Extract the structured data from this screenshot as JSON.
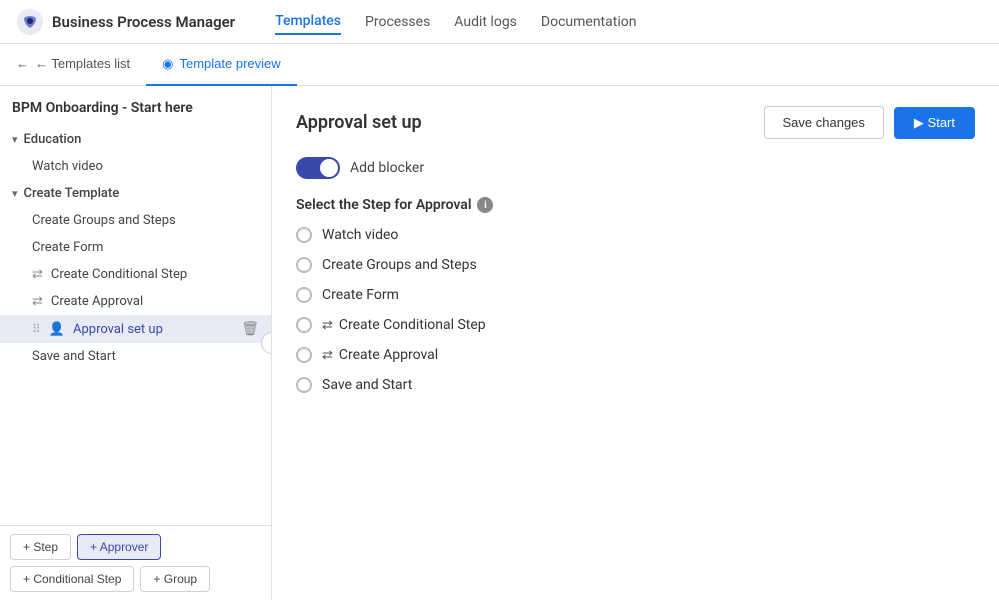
{
  "brand": {
    "name": "Business Process Manager"
  },
  "nav": {
    "items": [
      {
        "id": "templates",
        "label": "Templates",
        "active": true
      },
      {
        "id": "processes",
        "label": "Processes",
        "active": false
      },
      {
        "id": "audit-logs",
        "label": "Audit logs",
        "active": false
      },
      {
        "id": "documentation",
        "label": "Documentation",
        "active": false
      }
    ]
  },
  "tabs": [
    {
      "id": "templates-list",
      "label": "← Templates list",
      "active": false
    },
    {
      "id": "template-preview",
      "label": "Template preview",
      "active": true
    }
  ],
  "sidebar": {
    "title": "BPM Onboarding - Start here",
    "groups": [
      {
        "id": "education",
        "label": "Education",
        "expanded": true,
        "items": [
          {
            "id": "watch-video",
            "label": "Watch video",
            "icon": "",
            "active": false
          }
        ]
      },
      {
        "id": "create-template",
        "label": "Create Template",
        "expanded": true,
        "items": [
          {
            "id": "create-groups-steps",
            "label": "Create Groups and Steps",
            "icon": "",
            "active": false
          },
          {
            "id": "create-form",
            "label": "Create Form",
            "icon": "",
            "active": false
          },
          {
            "id": "create-conditional-step",
            "label": "Create Conditional Step",
            "icon": "⇄",
            "active": false
          },
          {
            "id": "create-approval",
            "label": "Create Approval",
            "icon": "⇄",
            "active": false
          },
          {
            "id": "approval-set-up",
            "label": "Approval set up",
            "icon": "👤",
            "active": true
          },
          {
            "id": "save-and-start",
            "label": "Save and Start",
            "icon": "",
            "active": false
          }
        ]
      }
    ],
    "actions": [
      {
        "id": "add-step",
        "label": "+ Step",
        "highlighted": false
      },
      {
        "id": "add-approver",
        "label": "+ Approver",
        "highlighted": true
      },
      {
        "id": "add-conditional-step",
        "label": "+ Conditional Step",
        "highlighted": false
      },
      {
        "id": "add-group",
        "label": "+ Group",
        "highlighted": false
      }
    ]
  },
  "main": {
    "title": "Approval set up",
    "save_label": "Save changes",
    "start_label": "▶ Start",
    "add_blocker_label": "Add blocker",
    "section_label": "Select the Step for Approval",
    "radio_options": [
      {
        "id": "watch-video",
        "label": "Watch video",
        "icon": ""
      },
      {
        "id": "create-groups-steps",
        "label": "Create Groups and Steps",
        "icon": ""
      },
      {
        "id": "create-form",
        "label": "Create Form",
        "icon": ""
      },
      {
        "id": "create-conditional-step",
        "label": "Create Conditional Step",
        "icon": "⇄"
      },
      {
        "id": "create-approval",
        "label": "Create Approval",
        "icon": "⇄"
      },
      {
        "id": "save-and-start",
        "label": "Save and Start",
        "icon": ""
      }
    ]
  }
}
